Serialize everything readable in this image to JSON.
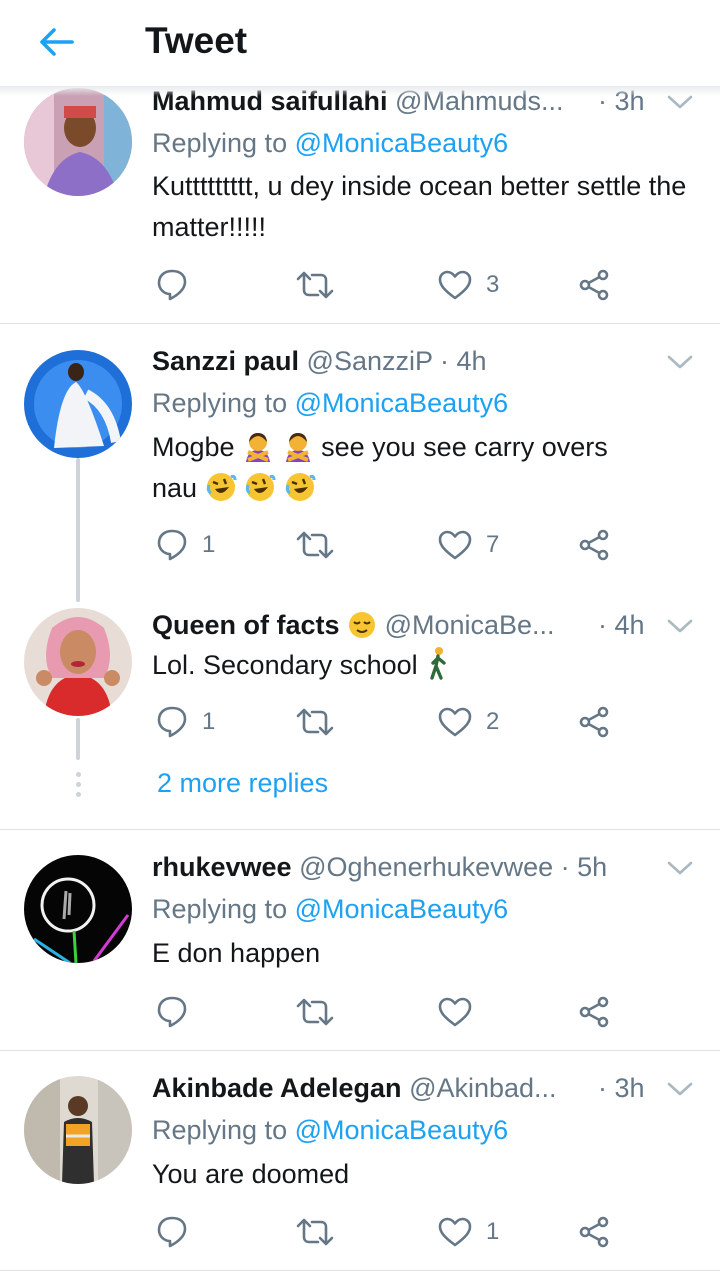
{
  "header": {
    "title": "Tweet"
  },
  "tweets": [
    {
      "name": "Mahmud saifullahi",
      "handle": "@Mahmuds...",
      "time": "· 3h",
      "replying_prefix": "Replying to",
      "mention": "@MonicaBeauty6",
      "body": "Kuttttttttt, u dey inside ocean better settle the matter!!!!!",
      "reply_count": "",
      "retweet_count": "",
      "like_count": "3"
    },
    {
      "name": "Sanzzi paul",
      "handle": "@SanzziP",
      "time": "· 4h",
      "replying_prefix": "Replying to",
      "mention": "@MonicaBeauty6",
      "body_line1_a": "Mogbe",
      "body_line1_b": "see you see carry overs",
      "body_line2": "nau",
      "reply_count": "1",
      "retweet_count": "",
      "like_count": "7"
    },
    {
      "name": "Queen of facts",
      "handle": "@MonicaBe...",
      "time": "· 4h",
      "body": "Lol. Secondary school",
      "reply_count": "1",
      "retweet_count": "",
      "like_count": "2"
    },
    {
      "name": "rhukevwee",
      "handle": "@Oghenerhukevwee",
      "time": "· 5h",
      "replying_prefix": "Replying to",
      "mention": "@MonicaBeauty6",
      "body": "E don happen",
      "reply_count": "",
      "retweet_count": "",
      "like_count": ""
    },
    {
      "name": "Akinbade Adelegan",
      "handle": "@Akinbad...",
      "time": "· 3h",
      "replying_prefix": "Replying to",
      "mention": "@MonicaBeauty6",
      "body": "You are doomed",
      "reply_count": "",
      "retweet_count": "",
      "like_count": "1"
    }
  ],
  "more_replies": "2 more replies",
  "icons": {
    "back": "arrow-left-icon",
    "reply": "reply-icon",
    "retweet": "retweet-icon",
    "like": "heart-icon",
    "share": "share-icon",
    "menu": "chevron-down-icon"
  },
  "colors": {
    "accent": "#1da1f2",
    "muted": "#657786",
    "text": "#14171a",
    "divider": "#dde2e6"
  }
}
